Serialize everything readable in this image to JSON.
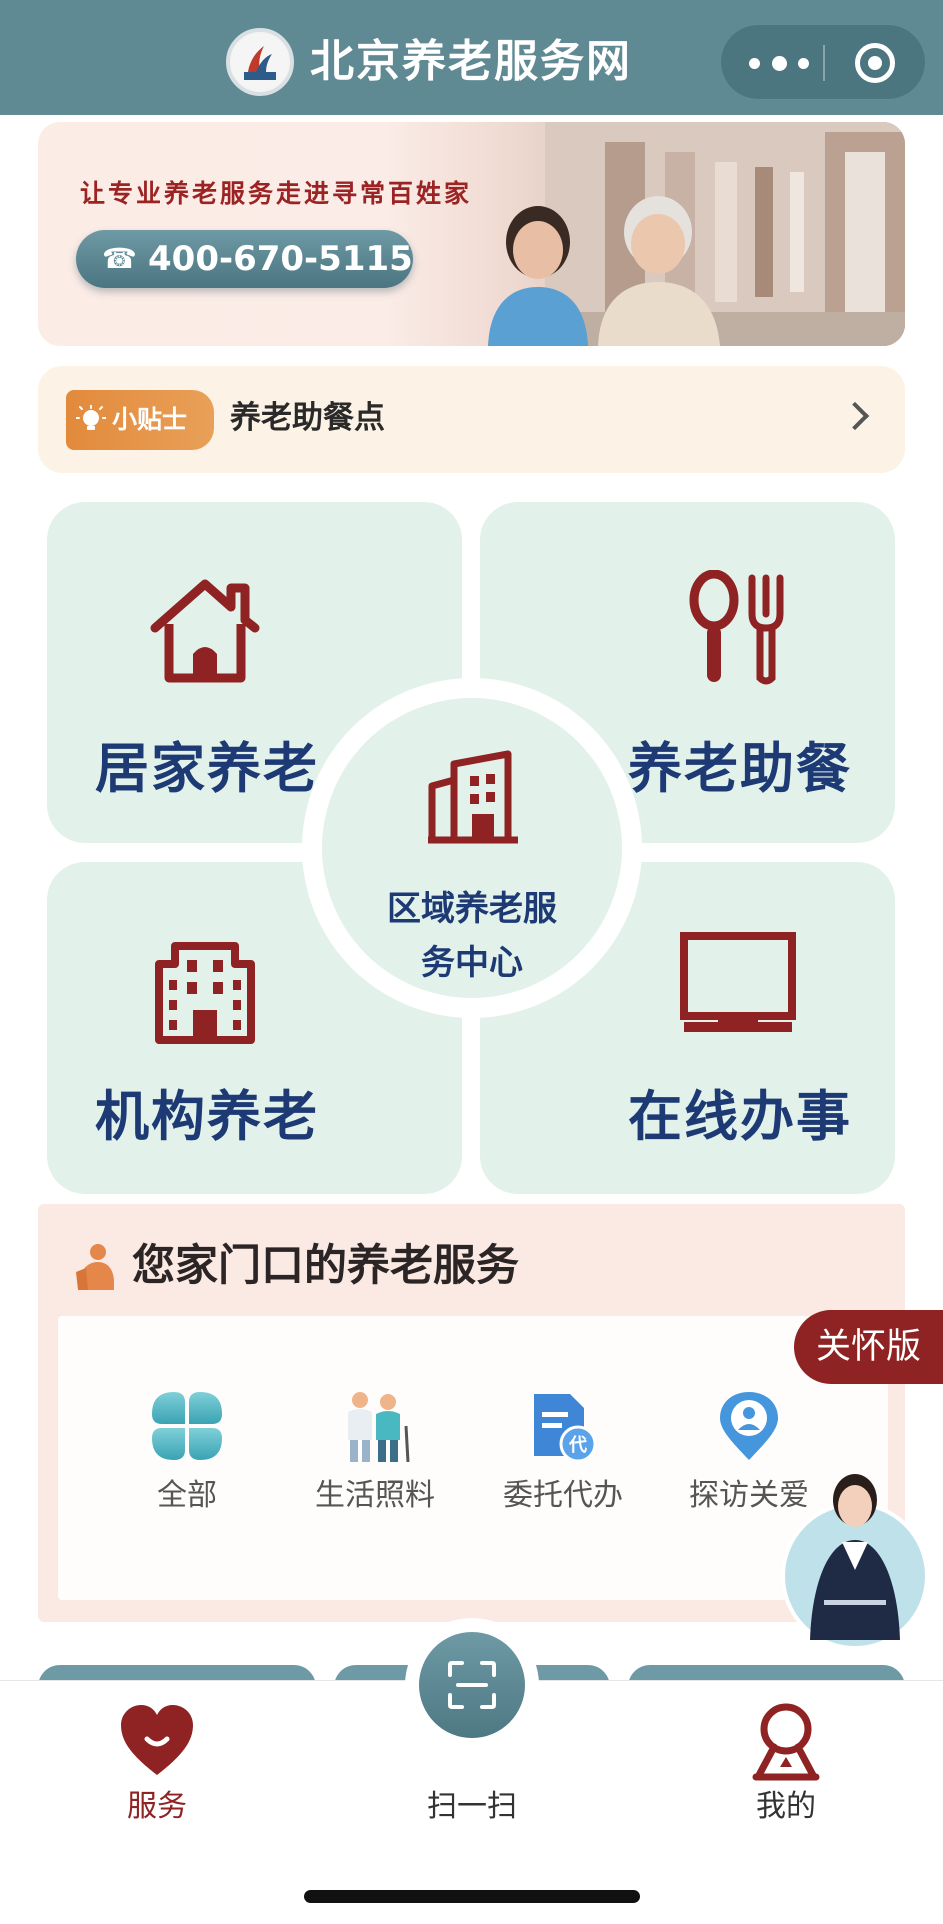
{
  "header": {
    "app_title": "北京养老服务网",
    "logo_icon": "beijing-elderly-logo",
    "capsule_icons": [
      "more-icon",
      "close-mini-icon"
    ]
  },
  "banner": {
    "slogan": "让专业养老服务走进寻常百姓家",
    "phone_icon": "☎",
    "phone_number": "400-670-5115"
  },
  "tip": {
    "badge_label": "小贴士",
    "text": "养老助餐点"
  },
  "tiles": {
    "home": "居家养老",
    "meal": "养老助餐",
    "institution": "机构养老",
    "online": "在线办事",
    "center": "区域养老服务中心",
    "center_line1": "区域养老服",
    "center_line2": "务中心"
  },
  "services": {
    "title": "您家门口的养老服务",
    "items": [
      {
        "label": "全部",
        "icon": "grid-petals-icon"
      },
      {
        "label": "生活照料",
        "icon": "caregiver-icon"
      },
      {
        "label": "委托代办",
        "icon": "document-proxy-icon"
      },
      {
        "label": "探访关爱",
        "icon": "location-person-icon"
      }
    ]
  },
  "care_mode": "关怀版",
  "tabbar": {
    "items": [
      {
        "label": "服务",
        "icon": "heart-smile-icon",
        "active": true
      },
      {
        "label": "扫一扫",
        "icon": "scan-icon",
        "active": false
      },
      {
        "label": "我的",
        "icon": "user-icon",
        "active": false
      }
    ]
  },
  "colors": {
    "header": "#5f8993",
    "accent_red": "#8f2222",
    "tile_bg": "#e2f2ea",
    "tile_text": "#1e3a75"
  }
}
